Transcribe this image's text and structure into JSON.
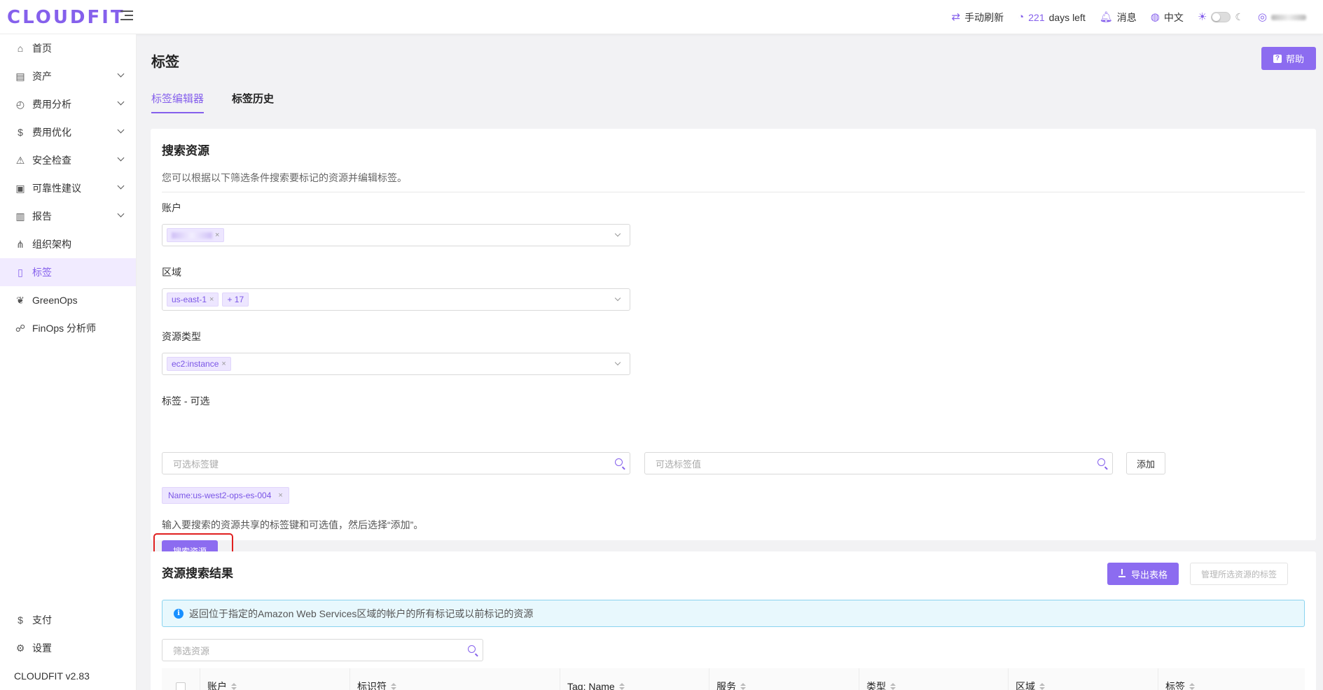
{
  "brand": {
    "logo": "CLOUDFIT",
    "accent_color": "#8560ec"
  },
  "topbar": {
    "refresh_label": "手动刷新",
    "days_number": "221",
    "days_suffix": "days left",
    "messages_label": "消息",
    "language_label": "中文"
  },
  "sidebar": {
    "items": [
      {
        "label": "首页",
        "icon": "home-icon"
      },
      {
        "label": "资产",
        "icon": "asset-icon"
      },
      {
        "label": "费用分析",
        "icon": "dashboard-icon"
      },
      {
        "label": "费用优化",
        "icon": "dollar-icon"
      },
      {
        "label": "安全检查",
        "icon": "alarm-icon"
      },
      {
        "label": "可靠性建议",
        "icon": "file-check-icon"
      },
      {
        "label": "报告",
        "icon": "report-icon"
      },
      {
        "label": "组织架构",
        "icon": "org-icon"
      },
      {
        "label": "标签",
        "icon": "tag-icon"
      },
      {
        "label": "GreenOps",
        "icon": "leaf-icon"
      },
      {
        "label": "FinOps 分析师",
        "icon": "analyst-icon"
      }
    ],
    "bottom_items": [
      {
        "label": "支付",
        "icon": "payment-icon"
      },
      {
        "label": "设置",
        "icon": "settings-icon"
      }
    ],
    "version": "CLOUDFIT v2.83"
  },
  "page": {
    "title": "标签",
    "help_label": "帮助",
    "tabs": [
      "标签编辑器",
      "标签历史"
    ]
  },
  "search_card": {
    "title": "搜索资源",
    "description": "您可以根据以下筛选条件搜索要标记的资源并编辑标签。",
    "account_label": "账户",
    "region_label": "区域",
    "region_chips": [
      "us-east-1",
      "+ 17"
    ],
    "resource_type_label": "资源类型",
    "resource_type_chip": "ec2:instance",
    "tags_label": "标签 - 可选",
    "tag_key_placeholder": "可选标签键",
    "tag_value_placeholder": "可选标签值",
    "add_label": "添加",
    "selected_tag": "Name:us-west2-ops-es-004",
    "hint": "输入要搜索的资源共享的标签键和可选值，然后选择“添加”。",
    "search_button": "搜索资源"
  },
  "results_card": {
    "title": "资源搜索结果",
    "export_label": "导出表格",
    "manage_label": "管理所选资源的标签",
    "info_text": "返回位于指定的Amazon Web Services区域的帐户的所有标记或以前标记的资源",
    "filter_placeholder": "筛选资源",
    "columns": [
      "账户",
      "标识符",
      "Tag: Name",
      "服务",
      "类型",
      "区域",
      "标签"
    ]
  }
}
